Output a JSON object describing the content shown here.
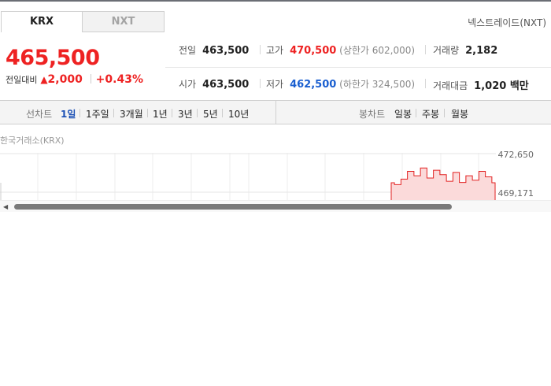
{
  "tabs": [
    {
      "label": "KRX",
      "active": true
    },
    {
      "label": "NXT",
      "active": false
    }
  ],
  "nxt_link": "넥스트레이드(NXT)",
  "price": {
    "current": "465,500",
    "change_label": "전일대비",
    "change_arrow": "▲",
    "change_value": "2,000",
    "change_percent": "+0.43%"
  },
  "stats": {
    "prev_close": {
      "label": "전일",
      "value": "463,500"
    },
    "high": {
      "label": "고가",
      "value": "470,500",
      "sub": "(상한가 602,000)"
    },
    "volume": {
      "label": "거래량",
      "value": "2,182"
    },
    "open": {
      "label": "시가",
      "value": "463,500"
    },
    "low": {
      "label": "저가",
      "value": "462,500",
      "sub": "(하한가 324,500)"
    },
    "amount": {
      "label": "거래대금",
      "value": "1,020 백만"
    }
  },
  "line_chart_label": "선차트",
  "periods": [
    "1일",
    "1주일",
    "3개월",
    "1년",
    "3년",
    "5년",
    "10년"
  ],
  "active_period": "1일",
  "candle_chart_label": "봉차트",
  "candle_periods": [
    "일봉",
    "주봉",
    "월봉"
  ],
  "exchange_label": "한국거래소(KRX)",
  "colors": {
    "up": "#e22222",
    "down": "#1a5fd0",
    "active": "#1a4fb5"
  },
  "chart_data": {
    "type": "area",
    "y_ticks": [
      "472,650",
      "469,171"
    ],
    "series": [
      {
        "values": [
          469171,
          469000,
          469500,
          470200,
          469800,
          470500,
          469600,
          470300,
          469900,
          469300,
          470100,
          469200,
          469800,
          469400,
          470200,
          469700,
          469171
        ]
      }
    ]
  }
}
